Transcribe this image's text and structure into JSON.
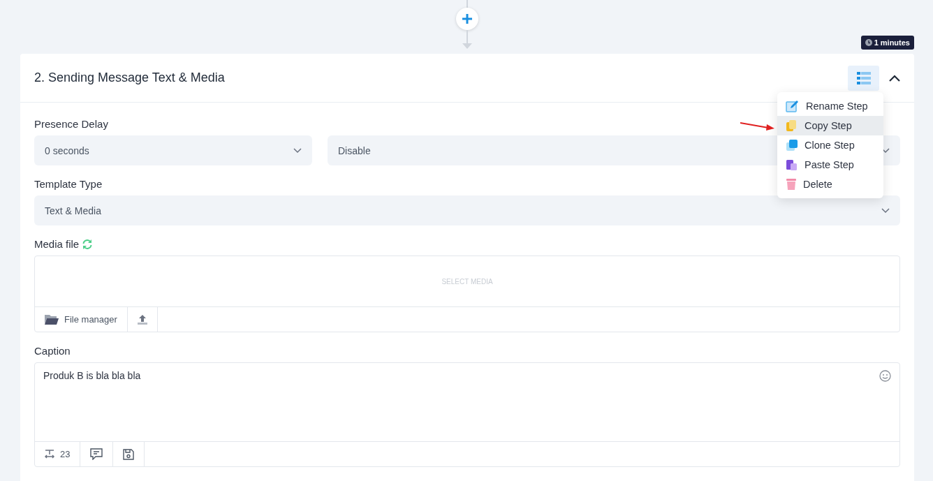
{
  "duration_badge": "1 minutes",
  "step": {
    "title": "2. Sending Message Text & Media",
    "expanded": true,
    "menu_open": true,
    "menu": [
      {
        "label": "Rename Step",
        "selected": false
      },
      {
        "label": "Copy Step",
        "selected": true
      },
      {
        "label": "Clone Step",
        "selected": false
      },
      {
        "label": "Paste Step",
        "selected": false
      },
      {
        "label": "Delete",
        "selected": false
      }
    ],
    "presence_delay": {
      "label": "Presence Delay",
      "selects": [
        {
          "value": "0 seconds"
        },
        {
          "value": "Disable"
        }
      ]
    },
    "template_type": {
      "label": "Template Type",
      "value": "Text & Media"
    },
    "media_file": {
      "label": "Media file",
      "drop_zone_text": "SELECT MEDIA",
      "file_manager_button": "File manager"
    },
    "caption": {
      "label": "Caption",
      "value": "Produk B is bla bla bla",
      "count": "23"
    }
  }
}
